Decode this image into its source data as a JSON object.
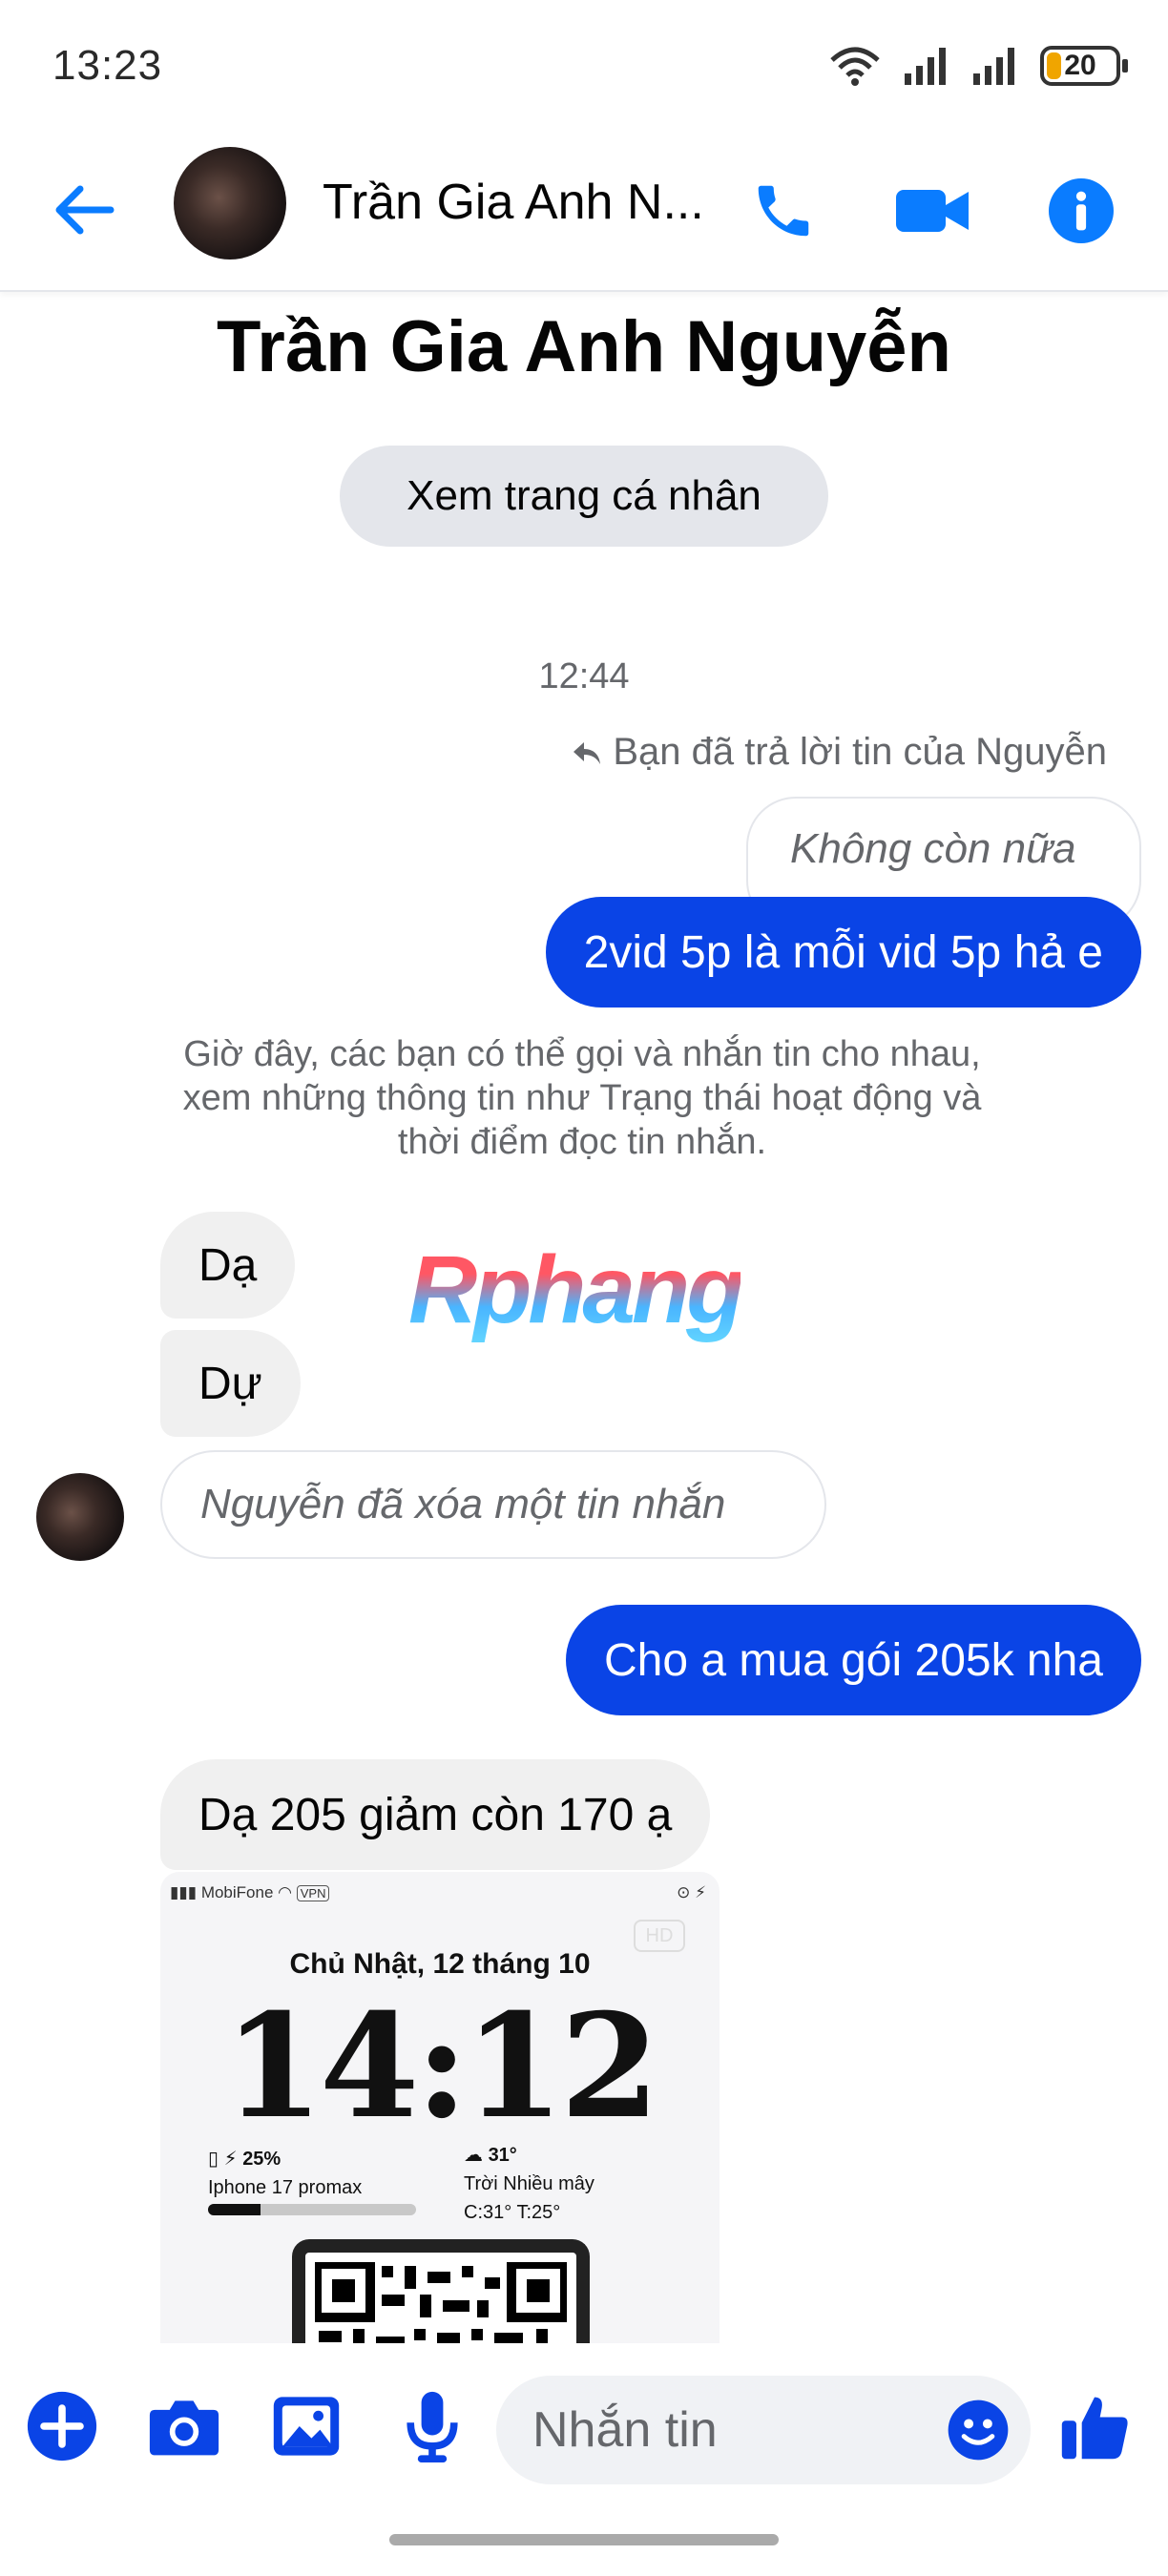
{
  "status_bar": {
    "time": "13:23",
    "battery": "20",
    "battery_level": 0.2
  },
  "header": {
    "contact_name": "Trần Gia Anh N..."
  },
  "profile": {
    "name": "Trần Gia Anh Nguyễn",
    "view_profile_label": "Xem trang cá nhân"
  },
  "conversation": {
    "timestamp": "12:44",
    "reply_meta": "Bạn đã trả lời tin của Nguyễn",
    "quoted_message": "Không còn nữa",
    "messages": [
      {
        "text": "2vid 5p là mỗi vid 5p hả e"
      },
      {
        "text": "Dạ"
      },
      {
        "text": "Dự"
      },
      {
        "text": "Cho a mua gói 205k nha"
      },
      {
        "text": "Dạ 205 giảm còn 170 ạ"
      }
    ],
    "notice": "Giờ đây, các bạn có thể gọi và nhắn tin cho nhau, xem những thông tin như Trạng thái hoạt động và thời điểm đọc tin nhắn.",
    "deleted_notice": "Nguyễn đã xóa một tin nhắn",
    "watermark": "Rphang",
    "attachment": {
      "carrier": "MobiFone",
      "vpn": "VPN",
      "hd": "HD",
      "date": "Chủ Nhật, 12 tháng 10",
      "clock": "14:12",
      "battery_percent": "25%",
      "battery_level": 0.25,
      "device_name": "Iphone 17 promax",
      "weather_temp": "31°",
      "weather_desc": "Trời Nhiều mây",
      "weather_range": "C:31° T:25°"
    }
  },
  "composer": {
    "placeholder": "Nhắn tin"
  },
  "colors": {
    "accent": "#0a7cff",
    "outgoing_bubble": "#0a44e6",
    "incoming_bubble": "#f0f0f0"
  }
}
